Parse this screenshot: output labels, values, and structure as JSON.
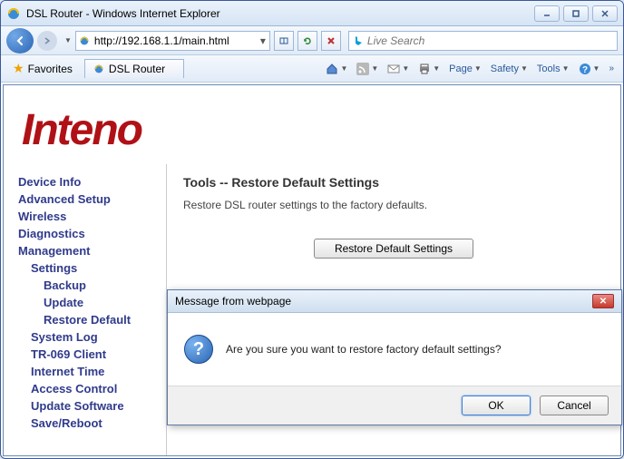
{
  "window": {
    "title": "DSL Router - Windows Internet Explorer"
  },
  "navbar": {
    "url": "http://192.168.1.1/main.html",
    "search_placeholder": "Live Search"
  },
  "favbar": {
    "favorites_label": "Favorites",
    "tab_label": "DSL Router",
    "menus": {
      "page": "Page",
      "safety": "Safety",
      "tools": "Tools"
    }
  },
  "logo_text": "Inteno",
  "sidebar": {
    "items": [
      {
        "label": "Device Info",
        "indent": 0
      },
      {
        "label": "Advanced Setup",
        "indent": 0
      },
      {
        "label": "Wireless",
        "indent": 0
      },
      {
        "label": "Diagnostics",
        "indent": 0
      },
      {
        "label": "Management",
        "indent": 0
      },
      {
        "label": "Settings",
        "indent": 1
      },
      {
        "label": "Backup",
        "indent": 2
      },
      {
        "label": "Update",
        "indent": 2
      },
      {
        "label": "Restore Default",
        "indent": 2
      },
      {
        "label": "System Log",
        "indent": 1
      },
      {
        "label": "TR-069 Client",
        "indent": 1
      },
      {
        "label": "Internet Time",
        "indent": 1
      },
      {
        "label": "Access Control",
        "indent": 1
      },
      {
        "label": "Update Software",
        "indent": 1
      },
      {
        "label": "Save/Reboot",
        "indent": 1
      }
    ]
  },
  "main": {
    "heading": "Tools -- Restore Default Settings",
    "description": "Restore DSL router settings to the factory defaults.",
    "button_label": "Restore Default Settings"
  },
  "dialog": {
    "title": "Message from webpage",
    "message": "Are you sure you want to restore factory default settings?",
    "ok_label": "OK",
    "cancel_label": "Cancel"
  }
}
